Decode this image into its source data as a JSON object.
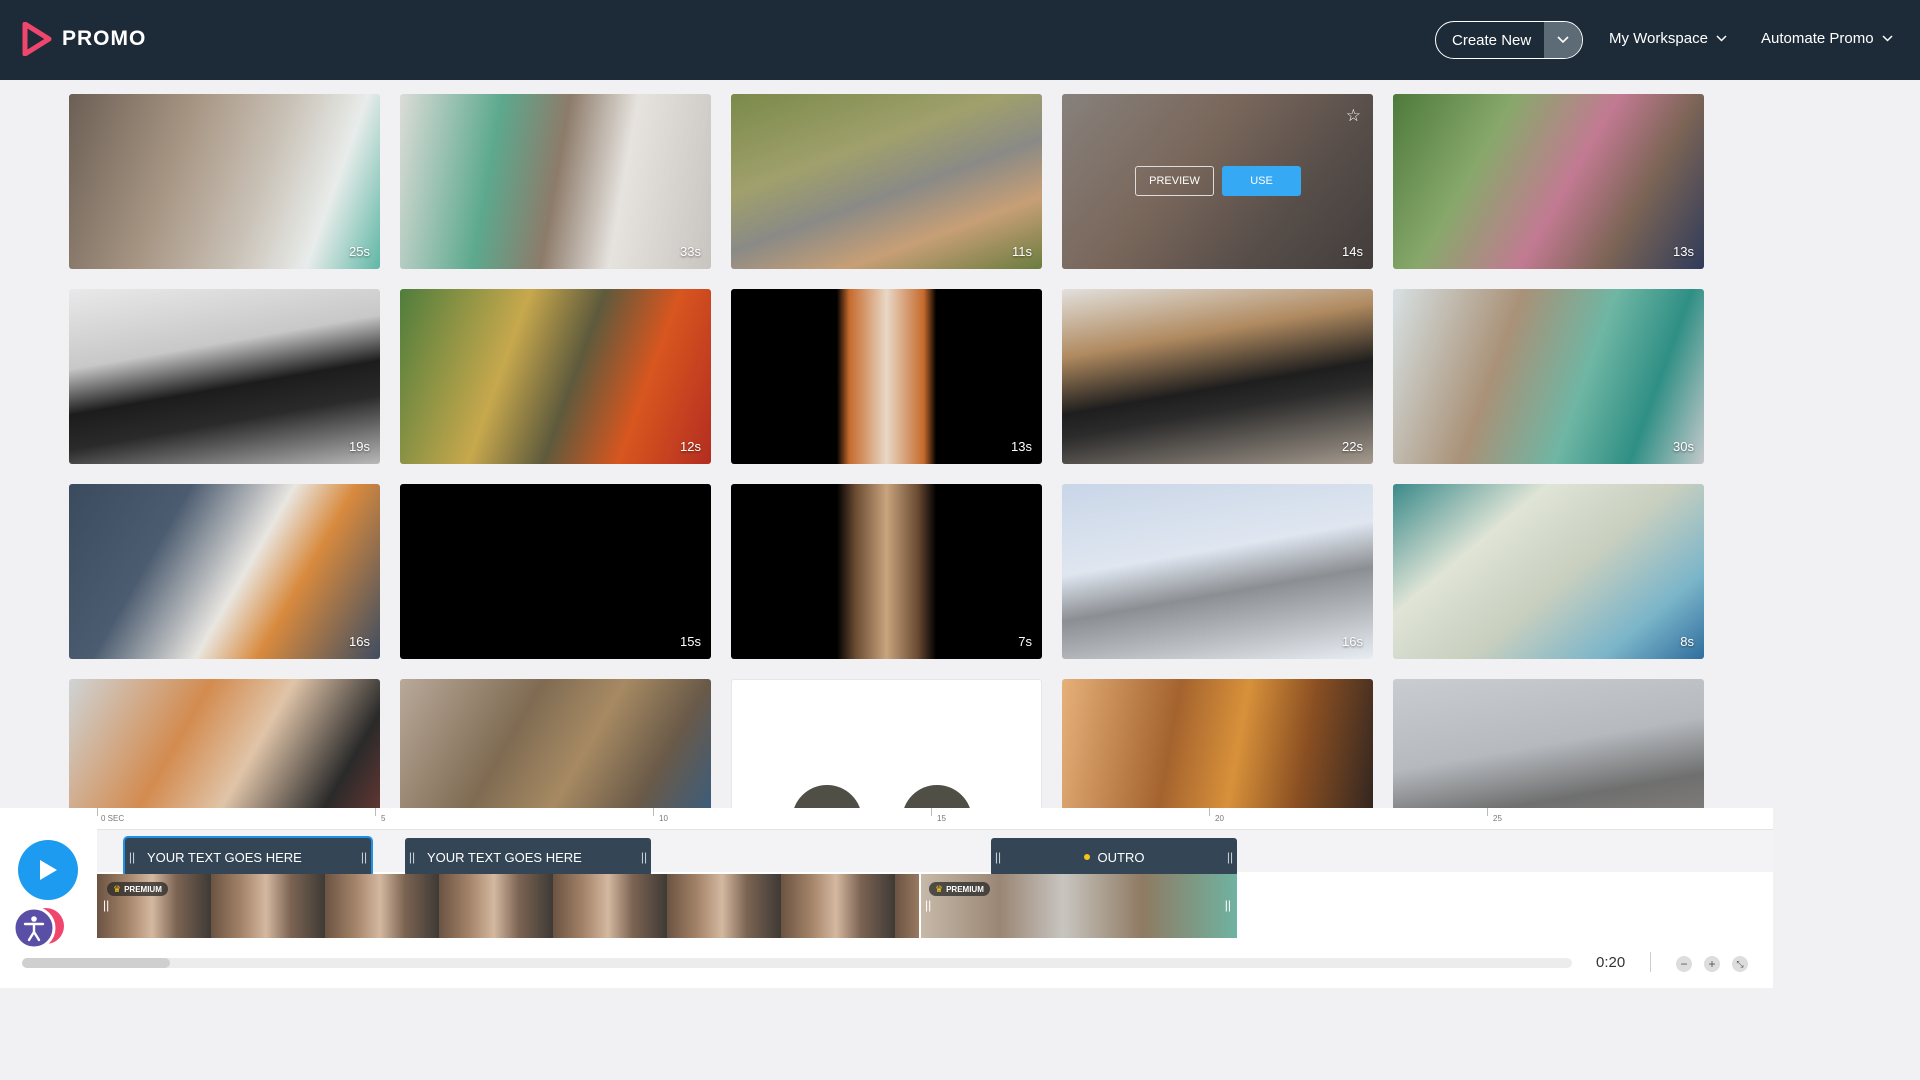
{
  "header": {
    "logo_text": "PROMO",
    "create_new_label": "Create New",
    "workspace_label": "My Workspace",
    "automate_label": "Automate Promo"
  },
  "grid": {
    "tiles": [
      {
        "duration": "25s"
      },
      {
        "duration": "33s"
      },
      {
        "duration": "11s"
      },
      {
        "duration": "14s"
      },
      {
        "duration": "13s"
      },
      {
        "duration": "19s"
      },
      {
        "duration": "12s"
      },
      {
        "duration": "13s"
      },
      {
        "duration": "22s"
      },
      {
        "duration": "30s"
      },
      {
        "duration": "16s"
      },
      {
        "duration": "15s"
      },
      {
        "duration": "7s"
      },
      {
        "duration": "16s"
      },
      {
        "duration": "8s"
      },
      {
        "duration": ""
      },
      {
        "duration": ""
      },
      {
        "duration": ""
      },
      {
        "duration": ""
      },
      {
        "duration": ""
      }
    ],
    "hover": {
      "preview_label": "PREVIEW",
      "use_label": "USE"
    }
  },
  "timeline": {
    "ruler": [
      "0 SEC",
      "5",
      "10",
      "15",
      "20",
      "25"
    ],
    "text_clips": [
      "YOUR TEXT GOES HERE",
      "YOUR TEXT GOES HERE"
    ],
    "outro_label": "OUTRO",
    "premium_label": "PREMIUM",
    "time": "0:20"
  },
  "colors": {
    "header_bg": "#1d2b38",
    "accent": "#1d9bf0",
    "clip_bg": "#344556"
  }
}
